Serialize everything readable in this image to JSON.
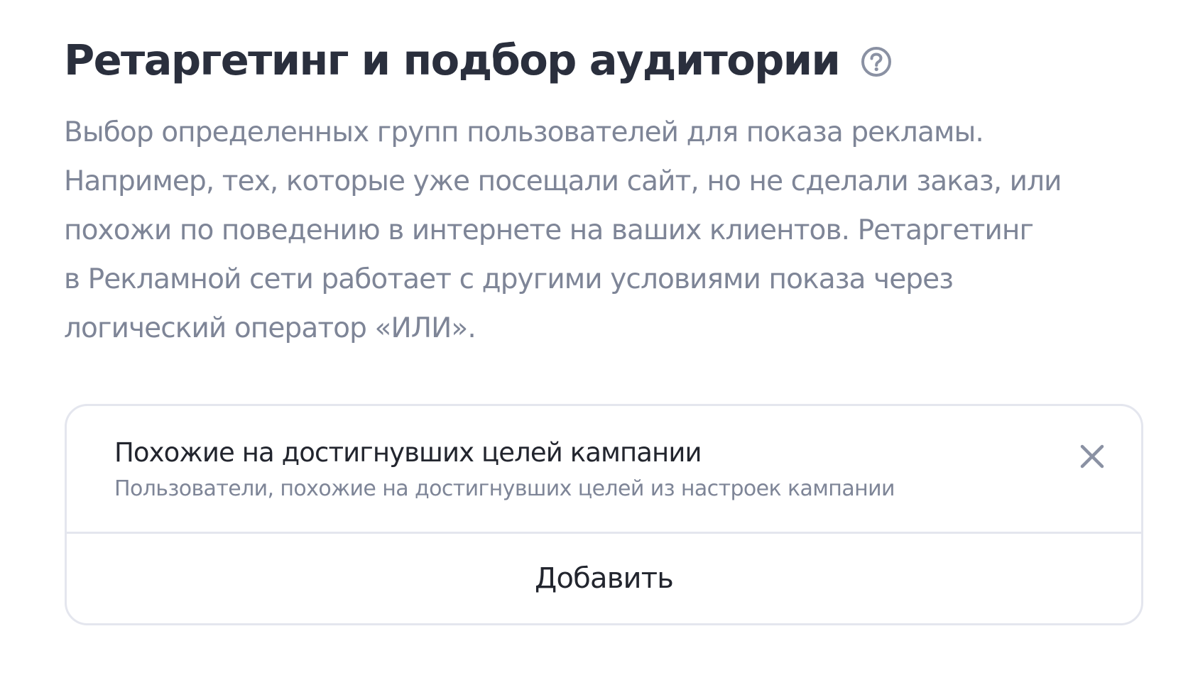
{
  "header": {
    "title": "Ретаргетинг и подбор аудитории",
    "help_icon": "question-circle-icon"
  },
  "description": {
    "lines": [
      "Выбор определенных групп пользователей для показа рекламы.",
      "Например, тех, которые уже посещали сайт, но не сделали заказ, или",
      "похожи по поведению в интернете на ваших клиентов. Ретаргетинг",
      "в Рекламной сети работает с другими условиями показа через",
      "логический оператор «ИЛИ»."
    ]
  },
  "audience_card": {
    "items": [
      {
        "title": "Похожие на достигнувших целей кампании",
        "subtitle": "Пользователи, похожие на достигнувших целей из настроек кампании",
        "remove_icon": "close-icon"
      }
    ],
    "add_label": "Добавить"
  },
  "colors": {
    "title": "#2a2f3d",
    "muted_text": "#7e8597",
    "primary_text": "#22252e",
    "border": "#e4e6ee",
    "icon": "#8a91a3"
  }
}
